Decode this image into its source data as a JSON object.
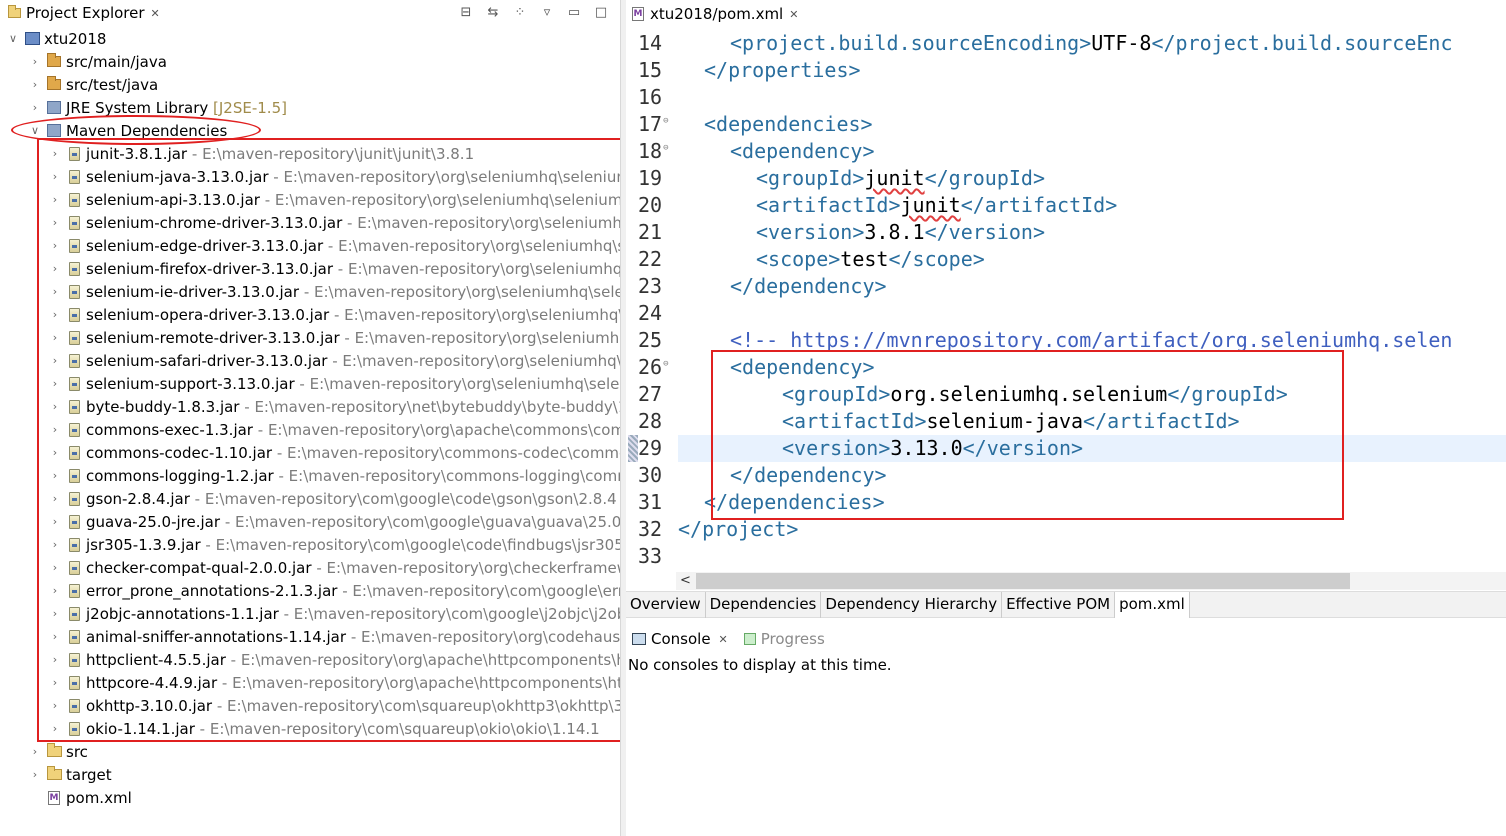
{
  "explorer": {
    "title": "Project Explorer",
    "close": "✕",
    "toolbar_icons": [
      "collapse-all-icon",
      "link-editor-icon",
      "view-menu-dots-icon",
      "view-menu-icon",
      "minimize-icon",
      "maximize-icon"
    ]
  },
  "tree": {
    "project": "xtu2018",
    "src_main": "src/main/java",
    "src_test": "src/test/java",
    "jre_label": "JRE System Library",
    "jre_decor": "[J2SE-1.5]",
    "maven_label": "Maven Dependencies",
    "jars": [
      {
        "name": "junit-3.8.1.jar",
        "path": "E:\\maven-repository\\junit\\junit\\3.8.1"
      },
      {
        "name": "selenium-java-3.13.0.jar",
        "path": "E:\\maven-repository\\org\\seleniumhq\\selenium\\"
      },
      {
        "name": "selenium-api-3.13.0.jar",
        "path": "E:\\maven-repository\\org\\seleniumhq\\selenium\\s"
      },
      {
        "name": "selenium-chrome-driver-3.13.0.jar",
        "path": "E:\\maven-repository\\org\\seleniumhq"
      },
      {
        "name": "selenium-edge-driver-3.13.0.jar",
        "path": "E:\\maven-repository\\org\\seleniumhq\\se"
      },
      {
        "name": "selenium-firefox-driver-3.13.0.jar",
        "path": "E:\\maven-repository\\org\\seleniumhq\\s"
      },
      {
        "name": "selenium-ie-driver-3.13.0.jar",
        "path": "E:\\maven-repository\\org\\seleniumhq\\selen"
      },
      {
        "name": "selenium-opera-driver-3.13.0.jar",
        "path": "E:\\maven-repository\\org\\seleniumhq\\s"
      },
      {
        "name": "selenium-remote-driver-3.13.0.jar",
        "path": "E:\\maven-repository\\org\\seleniumhq\\"
      },
      {
        "name": "selenium-safari-driver-3.13.0.jar",
        "path": "E:\\maven-repository\\org\\seleniumhq\\se"
      },
      {
        "name": "selenium-support-3.13.0.jar",
        "path": "E:\\maven-repository\\org\\seleniumhq\\seleni"
      },
      {
        "name": "byte-buddy-1.8.3.jar",
        "path": "E:\\maven-repository\\net\\bytebuddy\\byte-buddy\\1"
      },
      {
        "name": "commons-exec-1.3.jar",
        "path": "E:\\maven-repository\\org\\apache\\commons\\com"
      },
      {
        "name": "commons-codec-1.10.jar",
        "path": "E:\\maven-repository\\commons-codec\\commc"
      },
      {
        "name": "commons-logging-1.2.jar",
        "path": "E:\\maven-repository\\commons-logging\\comr"
      },
      {
        "name": "gson-2.8.4.jar",
        "path": "E:\\maven-repository\\com\\google\\code\\gson\\gson\\2.8.4"
      },
      {
        "name": "guava-25.0-jre.jar",
        "path": "E:\\maven-repository\\com\\google\\guava\\guava\\25.0-j"
      },
      {
        "name": "jsr305-1.3.9.jar",
        "path": "E:\\maven-repository\\com\\google\\code\\findbugs\\jsr305\\"
      },
      {
        "name": "checker-compat-qual-2.0.0.jar",
        "path": "E:\\maven-repository\\org\\checkerframew"
      },
      {
        "name": "error_prone_annotations-2.1.3.jar",
        "path": "E:\\maven-repository\\com\\google\\erro"
      },
      {
        "name": "j2objc-annotations-1.1.jar",
        "path": "E:\\maven-repository\\com\\google\\j2objc\\j2ob"
      },
      {
        "name": "animal-sniffer-annotations-1.14.jar",
        "path": "E:\\maven-repository\\org\\codehaus\\n"
      },
      {
        "name": "httpclient-4.5.5.jar",
        "path": "E:\\maven-repository\\org\\apache\\httpcomponents\\ht"
      },
      {
        "name": "httpcore-4.4.9.jar",
        "path": "E:\\maven-repository\\org\\apache\\httpcomponents\\ht"
      },
      {
        "name": "okhttp-3.10.0.jar",
        "path": "E:\\maven-repository\\com\\squareup\\okhttp3\\okhttp\\3."
      },
      {
        "name": "okio-1.14.1.jar",
        "path": "E:\\maven-repository\\com\\squareup\\okio\\okio\\1.14.1"
      }
    ],
    "path_sep": " - ",
    "src": "src",
    "target": "target",
    "pom": "pom.xml"
  },
  "editor": {
    "tab_title": "xtu2018/pom.xml",
    "tab_close": "✕",
    "line_numbers": [
      "14",
      "15",
      "16",
      "17",
      "18",
      "19",
      "20",
      "21",
      "22",
      "23",
      "24",
      "25",
      "26",
      "27",
      "28",
      "29",
      "30",
      "31",
      "32",
      "33"
    ],
    "fold_marker": "⊖",
    "code": {
      "l14_open": "<project.build.sourceEncoding>",
      "l14_val": "UTF-8",
      "l14_close": "</project.build.sourceEnc",
      "l15": "</properties>",
      "l17": "<dependencies>",
      "l18": "<dependency>",
      "l19_open": "<groupId>",
      "l19_val": "junit",
      "l19_close": "</groupId>",
      "l20_open": "<artifactId>",
      "l20_val": "junit",
      "l20_close": "</artifactId>",
      "l21_open": "<version>",
      "l21_val": "3.8.1",
      "l21_close": "</version>",
      "l22_open": "<scope>",
      "l22_val": "test",
      "l22_close": "</scope>",
      "l23": "</dependency>",
      "l25": "<!-- https://mvnrepository.com/artifact/org.seleniumhq.selen",
      "l26": "<dependency>",
      "l27_open": "<groupId>",
      "l27_val": "org.seleniumhq.selenium",
      "l27_close": "</groupId>",
      "l28_open": "<artifactId>",
      "l28_val": "selenium-java",
      "l28_close": "</artifactId>",
      "l29_open": "<version>",
      "l29_val": "3.13.0",
      "l29_close": "</version>",
      "l30": "</dependency>",
      "l31": "</dependencies>",
      "l32": "</project>"
    }
  },
  "scroll_left_arrow": "<",
  "pom_tabs": [
    "Overview",
    "Dependencies",
    "Dependency Hierarchy",
    "Effective POM",
    "pom.xml"
  ],
  "console": {
    "tab_console": "Console",
    "tab_close": "✕",
    "tab_progress": "Progress",
    "message": "No consoles to display at this time."
  },
  "colors": {
    "tag": "#2a6e9e",
    "comment": "#3f5fbf",
    "annotation": "#e02020",
    "path": "#7b7b7b"
  }
}
